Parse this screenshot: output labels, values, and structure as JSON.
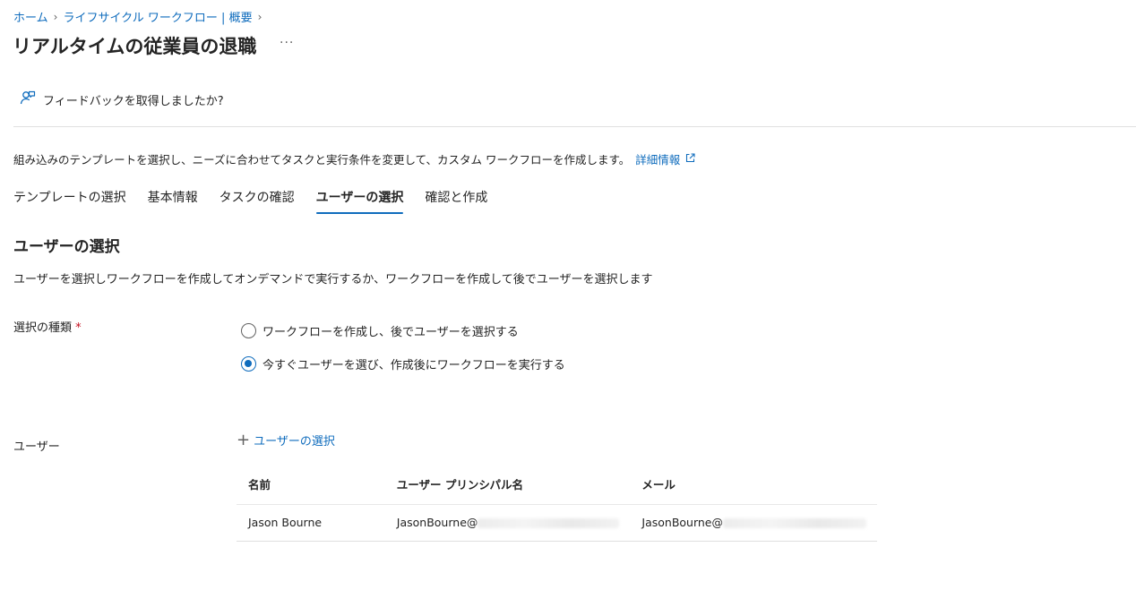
{
  "breadcrumb": {
    "items": [
      "ホーム",
      "ライフサイクル ワークフロー | 概要"
    ],
    "separator": ">"
  },
  "page": {
    "title": "リアルタイムの従業員の退職",
    "more": "···"
  },
  "feedback": {
    "label": "フィードバックを取得しましたか?",
    "icon": "person-feedback-icon"
  },
  "description": {
    "text": "組み込みのテンプレートを選択し、ニーズに合わせてタスクと実行条件を変更して、カスタム ワークフローを作成します。",
    "link": "詳細情報",
    "link_icon": "open-external-icon"
  },
  "tabs": [
    {
      "label": "テンプレートの選択"
    },
    {
      "label": "基本情報"
    },
    {
      "label": "タスクの確認"
    },
    {
      "label": "ユーザーの選択",
      "active": true
    },
    {
      "label": "確認と作成"
    }
  ],
  "section": {
    "title": "ユーザーの選択",
    "description": "ユーザーを選択しワークフローを作成してオンデマンドで実行するか、ワークフローを作成して後でユーザーを選択します"
  },
  "selection_type": {
    "label": "選択の種類",
    "required_mark": "*",
    "options": [
      {
        "label": "ワークフローを作成し、後でユーザーを選択する",
        "checked": false
      },
      {
        "label": "今すぐユーザーを選び、作成後にワークフローを実行する",
        "checked": true
      }
    ]
  },
  "users": {
    "label": "ユーザー",
    "add_button": "ユーザーの選択",
    "add_icon": "plus-icon",
    "columns": [
      "名前",
      "ユーザー プリンシパル名",
      "メール"
    ],
    "rows": [
      {
        "name": "Jason Bourne",
        "upn": "JasonBourne@",
        "email": "JasonBourne@"
      }
    ]
  },
  "colors": {
    "accent": "#0f6cbd",
    "required": "#c50f1f",
    "text": "#242424"
  }
}
